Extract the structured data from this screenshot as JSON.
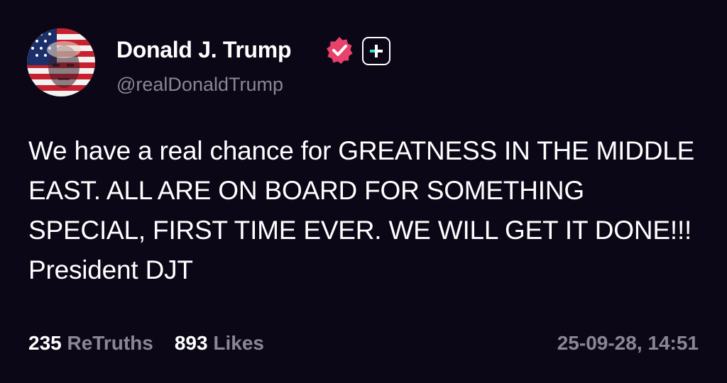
{
  "author": {
    "display_name": "Donald J. Trump",
    "handle": "@realDonaldTrump",
    "avatar_icon": "american-flag-portrait-avatar",
    "verified_icon": "verified-badge-icon",
    "follow_icon": "plus-icon"
  },
  "post": {
    "text": "We have a real chance for GREATNESS IN THE MIDDLE EAST. ALL ARE ON BOARD FOR SOMETHING SPECIAL, FIRST TIME EVER. WE WILL GET IT DONE!!! President DJT"
  },
  "stats": {
    "retruths_count": "235",
    "retruths_label": "ReTruths",
    "likes_count": "893",
    "likes_label": "Likes"
  },
  "timestamp": "25-09-28, 14:51",
  "colors": {
    "background": "#0b0717",
    "text": "#ffffff",
    "muted": "#8a8697",
    "verified": "#e8426a",
    "accent": "#2ee6c4"
  }
}
